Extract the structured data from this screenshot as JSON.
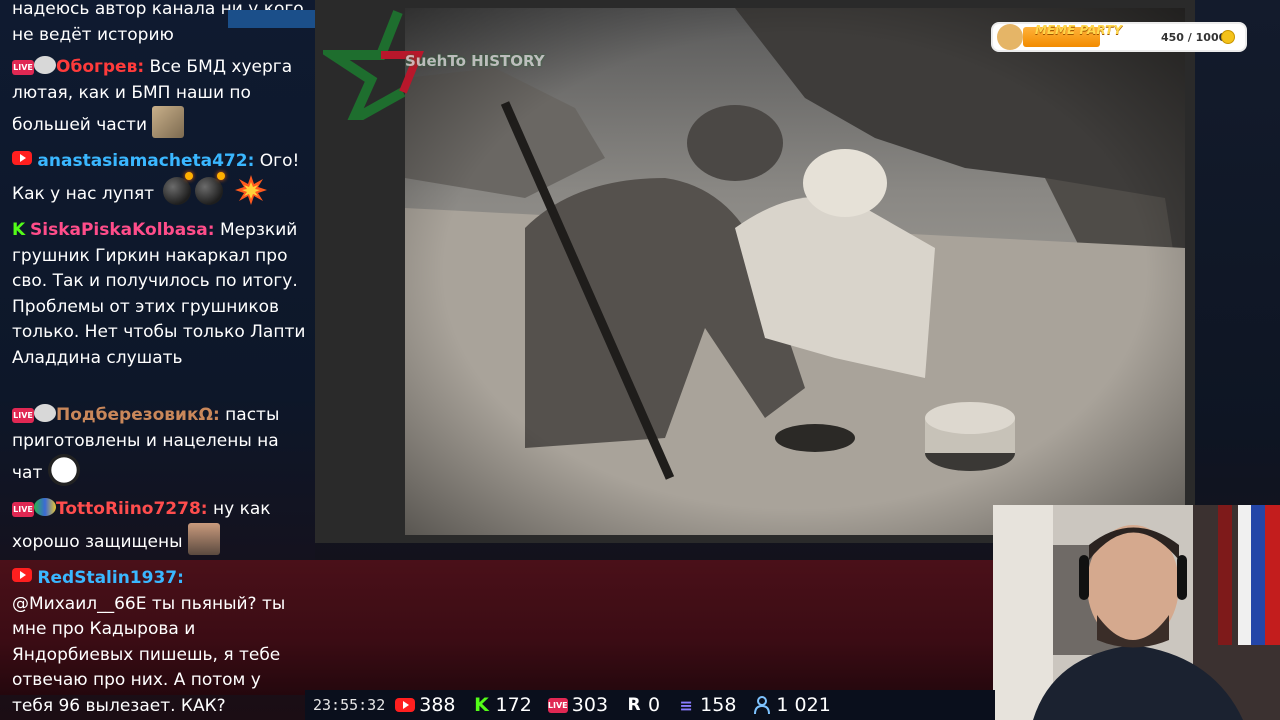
{
  "chat": {
    "messages": [
      {
        "name": "",
        "color": "#ffffff",
        "platform": "",
        "text": "надеюсь автор канала ни у кого не ведёт историю"
      },
      {
        "name": "Обогрев:",
        "color": "#ff3b3b",
        "platform": "live",
        "text": "Все БМД хуерга лютая, как и БМП наши по большей части"
      },
      {
        "name": "anastasiamacheta472:",
        "color": "#3ab7ff",
        "platform": "youtube",
        "text": "Ого! Как у нас лупят"
      },
      {
        "name": "SiskaPiskaKolbasa:",
        "color": "#ff4d8a",
        "platform": "kick",
        "text": "Мерзкий грушник Гиркин накаркал про сво. Так и получилось по итогу. Проблемы от этих грушников только. Нет чтобы только Лапти Аладдина слушать"
      },
      {
        "name": "ПодберезовикΩ:",
        "color": "#c9875a",
        "platform": "live",
        "text": "пасты приготовлены и нацелены на чат"
      },
      {
        "name": "TottoRiino7278:",
        "color": "#ff4d4d",
        "platform": "live",
        "text": "ну как хорошо защищены"
      },
      {
        "name": "RedStalin1937:",
        "color": "#3ab7ff",
        "platform": "youtube",
        "text": "@Михаил__66Е ты пьяный? ты мне про Кадырова и Яндорбиевых пишешь, я тебе отвечаю про них. А потом у тебя 96 вылезает. КАК?"
      }
    ]
  },
  "meme_party": {
    "title": "MEME PARTY",
    "count": "450 / 1000",
    "progress": 0.45
  },
  "video": {
    "watermark": "SuehTo HISTORY"
  },
  "status": {
    "clock": "23:55:32",
    "youtube_viewers": "388",
    "kick_viewers": "172",
    "live_viewers": "303",
    "rumble_viewers": "0",
    "other_viewers": "158",
    "total_viewers": "1 021"
  },
  "colors": {
    "youtube": "#ff1f1f",
    "kick": "#53fc18",
    "live": "#e02853",
    "accent_blue": "#3ab7ff"
  }
}
